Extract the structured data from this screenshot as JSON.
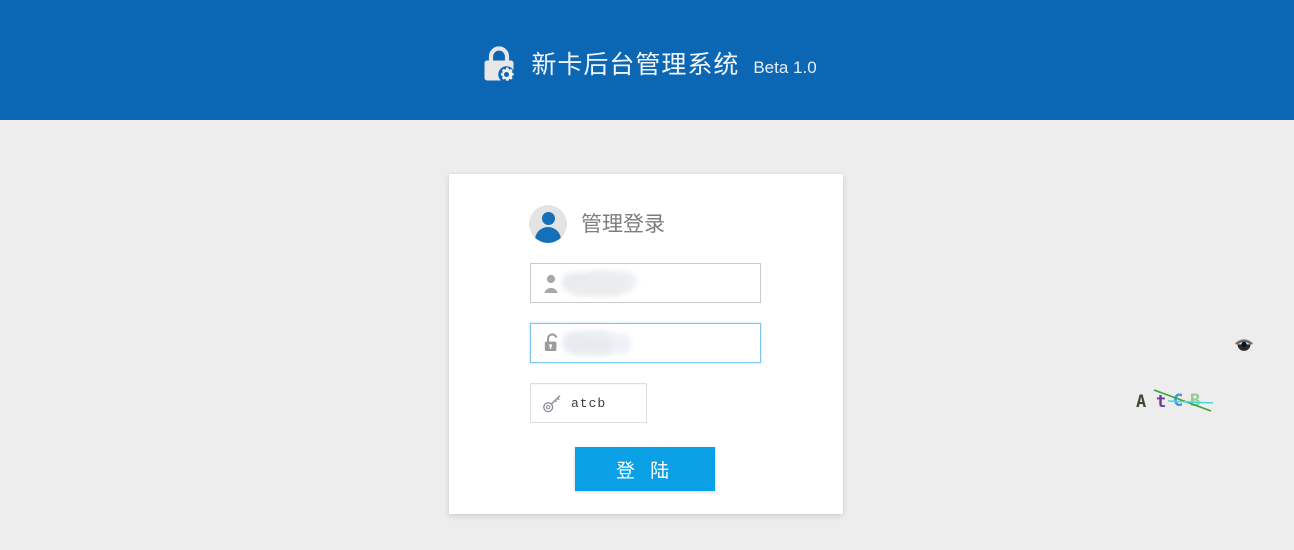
{
  "header": {
    "icon": "lock-gear-icon",
    "title": "新卡后台管理系统",
    "version": "Beta 1.0",
    "background_color": "#0b66b4"
  },
  "page": {
    "background_color": "#ededed"
  },
  "login_card": {
    "avatar_icon": "user-avatar-icon",
    "title": "管理登录",
    "username": {
      "icon": "user-icon",
      "value": "",
      "placeholder": "",
      "redacted": true
    },
    "password": {
      "icon": "unlock-icon",
      "value": "",
      "placeholder": "",
      "redacted": true,
      "focused": true,
      "toggle_icon": "eye-icon"
    },
    "captcha": {
      "icon": "key-icon",
      "value": "atcb",
      "placeholder": "",
      "image_text": "AtCB",
      "image_chars": [
        {
          "ch": "A",
          "color": "#3c4a33"
        },
        {
          "ch": "t",
          "color": "#6b3ba0"
        },
        {
          "ch": "C",
          "color": "#3d96e8"
        },
        {
          "ch": "B",
          "color": "#8fce8f"
        }
      ],
      "noise_line_colors": [
        "#3aa33a",
        "#45d9d9"
      ]
    },
    "submit": {
      "label": "登 陆",
      "color": "#09a0e6",
      "text_color": "#ffffff"
    }
  }
}
